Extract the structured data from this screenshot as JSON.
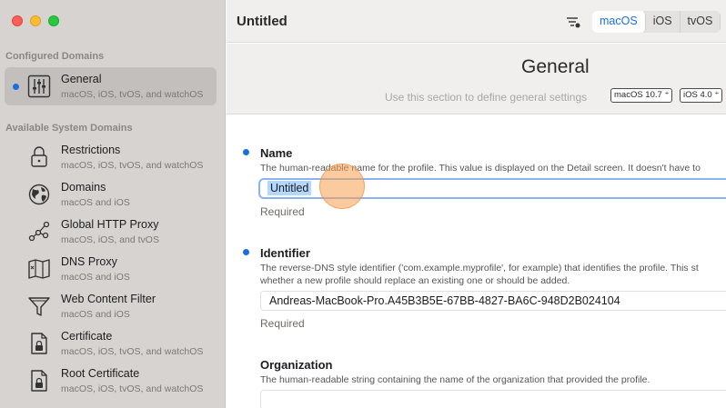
{
  "sidebar": {
    "configured_title": "Configured Domains",
    "available_title": "Available System Domains",
    "configured": [
      {
        "icon": "sliders-icon",
        "title": "General",
        "sub": "macOS, iOS, tvOS, and watchOS"
      }
    ],
    "available": [
      {
        "icon": "lock-icon",
        "title": "Restrictions",
        "sub": "macOS, iOS, tvOS, and watchOS"
      },
      {
        "icon": "globe-icon",
        "title": "Domains",
        "sub": "macOS and iOS"
      },
      {
        "icon": "network-nodes-icon",
        "title": "Global HTTP Proxy",
        "sub": "macOS, iOS, and tvOS"
      },
      {
        "icon": "map-icon",
        "title": "DNS Proxy",
        "sub": "macOS and iOS"
      },
      {
        "icon": "funnel-icon",
        "title": "Web Content Filter",
        "sub": "macOS and iOS"
      },
      {
        "icon": "certificate-icon",
        "title": "Certificate",
        "sub": "macOS, iOS, tvOS, and watchOS"
      },
      {
        "icon": "certificate-icon",
        "title": "Root Certificate",
        "sub": "macOS, iOS, tvOS, and watchOS"
      }
    ]
  },
  "toolbar": {
    "title": "Untitled",
    "platforms": [
      "macOS",
      "iOS",
      "tvOS"
    ],
    "active_platform": "macOS"
  },
  "header": {
    "title": "General",
    "description": "Use this section to define general settings",
    "badges": [
      "macOS 10.7 ⁺",
      "iOS 4.0 ⁺"
    ]
  },
  "fields": {
    "name": {
      "label": "Name",
      "description": "The human-readable name for the profile. This value is displayed on the Detail screen. It doesn't have to",
      "value": "Untitled",
      "required": "Required"
    },
    "identifier": {
      "label": "Identifier",
      "description_1": "The reverse-DNS style identifier ('com.example.myprofile', for example) that identifies the profile. This st",
      "description_2": "whether a new profile should replace an existing one or should be added.",
      "value": "Andreas-MacBook-Pro.A45B3B5E-67BB-4827-BA6C-948D2B024104",
      "required": "Required"
    },
    "organization": {
      "label": "Organization",
      "description": "The human-readable string containing the name of the organization that provided the profile."
    }
  },
  "colors": {
    "accent": "#1a6fe0",
    "sidebar_bg": "#d6d3d1",
    "selection": "#b3d7ff"
  }
}
